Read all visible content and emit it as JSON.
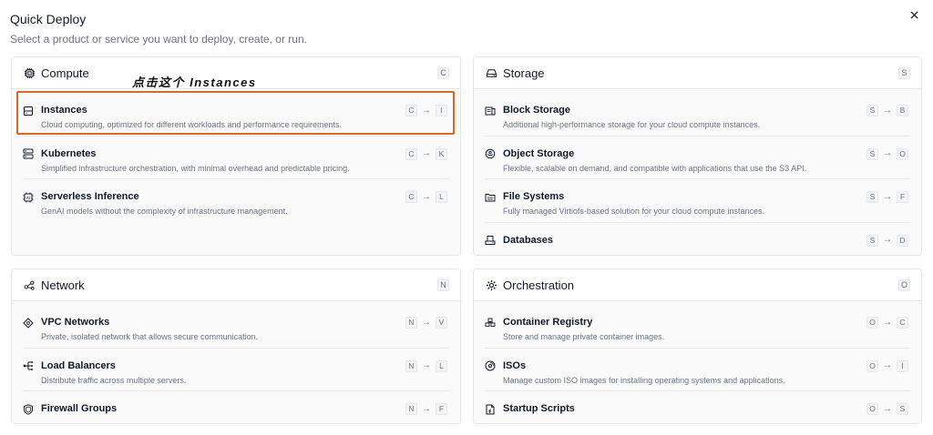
{
  "header": {
    "title": "Quick Deploy",
    "subtitle": "Select a product or service you want to deploy, create, or run."
  },
  "annotation": "点击这个 Instances",
  "sections": {
    "compute": {
      "title": "Compute",
      "key": "C",
      "items": [
        {
          "title": "Instances",
          "desc": "Cloud computing, optimized for different workloads and performance requirements.",
          "k1": "C",
          "arrow": "→",
          "k2": "I"
        },
        {
          "title": "Kubernetes",
          "desc": "Simplified infrastructure orchestration, with minimal overhead and predictable pricing.",
          "k1": "C",
          "arrow": "→",
          "k2": "K"
        },
        {
          "title": "Serverless Inference",
          "desc": "GenAI models without the complexity of infrastructure management.",
          "k1": "C",
          "arrow": "→",
          "k2": "L"
        }
      ]
    },
    "storage": {
      "title": "Storage",
      "key": "S",
      "items": [
        {
          "title": "Block Storage",
          "desc": "Additional high-performance storage for your cloud compute instances.",
          "k1": "S",
          "arrow": "→",
          "k2": "B"
        },
        {
          "title": "Object Storage",
          "desc": "Flexible, scalable on demand, and compatible with applications that use the S3 API.",
          "k1": "S",
          "arrow": "→",
          "k2": "O"
        },
        {
          "title": "File Systems",
          "desc": "Fully managed Virtiofs-based solution for your cloud compute instances.",
          "k1": "S",
          "arrow": "→",
          "k2": "F"
        },
        {
          "title": "Databases",
          "desc": "",
          "k1": "S",
          "arrow": "→",
          "k2": "D"
        }
      ]
    },
    "network": {
      "title": "Network",
      "key": "N",
      "items": [
        {
          "title": "VPC Networks",
          "desc": "Private, isolated network that allows secure communication.",
          "k1": "N",
          "arrow": "→",
          "k2": "V"
        },
        {
          "title": "Load Balancers",
          "desc": "Distribute traffic across multiple servers.",
          "k1": "N",
          "arrow": "→",
          "k2": "L"
        },
        {
          "title": "Firewall Groups",
          "desc": "",
          "k1": "N",
          "arrow": "→",
          "k2": "F"
        }
      ]
    },
    "orchestration": {
      "title": "Orchestration",
      "key": "O",
      "items": [
        {
          "title": "Container Registry",
          "desc": "Store and manage private container images.",
          "k1": "O",
          "arrow": "→",
          "k2": "C"
        },
        {
          "title": "ISOs",
          "desc": "Manage custom ISO images for installing operating systems and applications.",
          "k1": "O",
          "arrow": "→",
          "k2": "I"
        },
        {
          "title": "Startup Scripts",
          "desc": "",
          "k1": "O",
          "arrow": "→",
          "k2": "S"
        }
      ]
    }
  },
  "colors": {
    "highlight": "#d9692b",
    "border": "#e5e7eb",
    "text": "#111827",
    "muted": "#6b7280"
  }
}
